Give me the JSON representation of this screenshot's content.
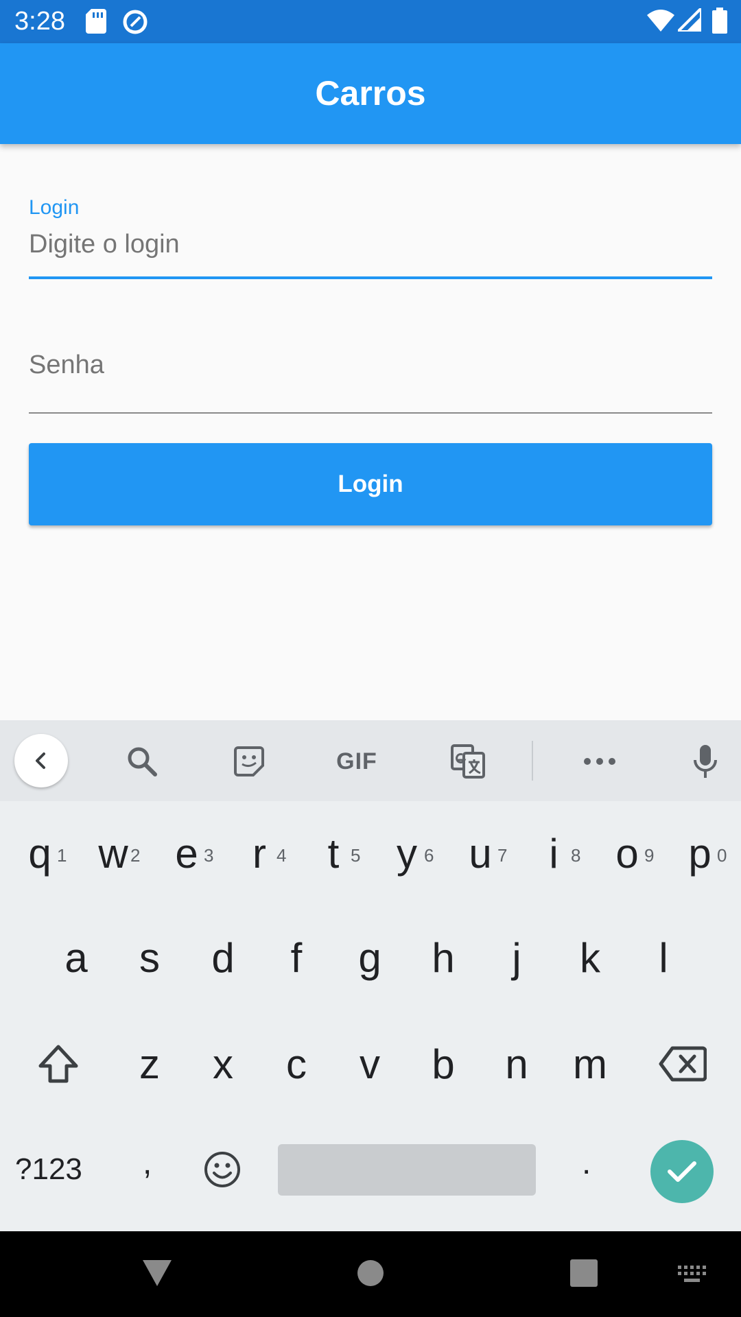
{
  "status_bar": {
    "time": "3:28",
    "icons": [
      "sd-card-icon",
      "sync-icon",
      "wifi-icon",
      "signal-icon",
      "battery-icon"
    ]
  },
  "app_bar": {
    "title": "Carros"
  },
  "form": {
    "login_field": {
      "label": "Login",
      "placeholder": "Digite o login",
      "value": ""
    },
    "password_field": {
      "placeholder": "Senha",
      "value": ""
    },
    "login_button": "Login"
  },
  "keyboard": {
    "toolbar_icons": [
      "back-chevron-icon",
      "search-icon",
      "sticker-icon",
      "gif-icon",
      "translate-icon",
      "more-icon",
      "mic-icon"
    ],
    "gif_label": "GIF",
    "row1": [
      "q",
      "w",
      "e",
      "r",
      "t",
      "y",
      "u",
      "i",
      "o",
      "p"
    ],
    "row1_numbers": [
      "1",
      "2",
      "3",
      "4",
      "5",
      "6",
      "7",
      "8",
      "9",
      "0"
    ],
    "row2": [
      "a",
      "s",
      "d",
      "f",
      "g",
      "h",
      "j",
      "k",
      "l"
    ],
    "row3": [
      "z",
      "x",
      "c",
      "v",
      "b",
      "n",
      "m"
    ],
    "symbols_key": "?123",
    "comma_key": ",",
    "period_key": "."
  },
  "colors": {
    "status_bar": "#1976d2",
    "primary": "#2196f3",
    "enter_key": "#4db6ac",
    "keyboard_bg": "#eceff1"
  }
}
